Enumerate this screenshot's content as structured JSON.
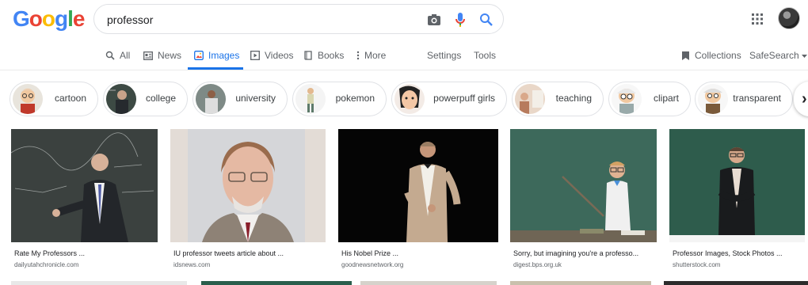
{
  "logo": {
    "letters": [
      "G",
      "o",
      "o",
      "g",
      "l",
      "e"
    ],
    "colors": [
      "#4285F4",
      "#EA4335",
      "#FBBC05",
      "#4285F4",
      "#34A853",
      "#EA4335"
    ]
  },
  "search": {
    "query": "professor"
  },
  "tabs": [
    {
      "label": "All",
      "icon": "search-icon"
    },
    {
      "label": "News",
      "icon": "news-icon"
    },
    {
      "label": "Images",
      "icon": "image-icon",
      "active": true
    },
    {
      "label": "Videos",
      "icon": "play-icon"
    },
    {
      "label": "Books",
      "icon": "book-icon"
    },
    {
      "label": "More",
      "icon": "more-vert-icon"
    },
    {
      "label": "Settings"
    },
    {
      "label": "Tools"
    }
  ],
  "right_tools": {
    "collections": "Collections",
    "safesearch": "SafeSearch"
  },
  "chips": [
    {
      "label": "cartoon"
    },
    {
      "label": "college"
    },
    {
      "label": "university"
    },
    {
      "label": "pokemon"
    },
    {
      "label": "powerpuff girls"
    },
    {
      "label": "teaching"
    },
    {
      "label": "clipart"
    },
    {
      "label": "transparent"
    }
  ],
  "results": [
    {
      "title": "Rate My Professors ...",
      "source": "dailyutahchronicle.com"
    },
    {
      "title": "IU professor tweets article about ...",
      "source": "idsnews.com"
    },
    {
      "title": "His Nobel Prize ...",
      "source": "goodnewsnetwork.org"
    },
    {
      "title": "Sorry, but imagining you're a professo...",
      "source": "digest.bps.org.uk"
    },
    {
      "title": "Professor Images, Stock Photos ...",
      "source": "shutterstock.com"
    }
  ],
  "accent_color": "#1a73e8"
}
